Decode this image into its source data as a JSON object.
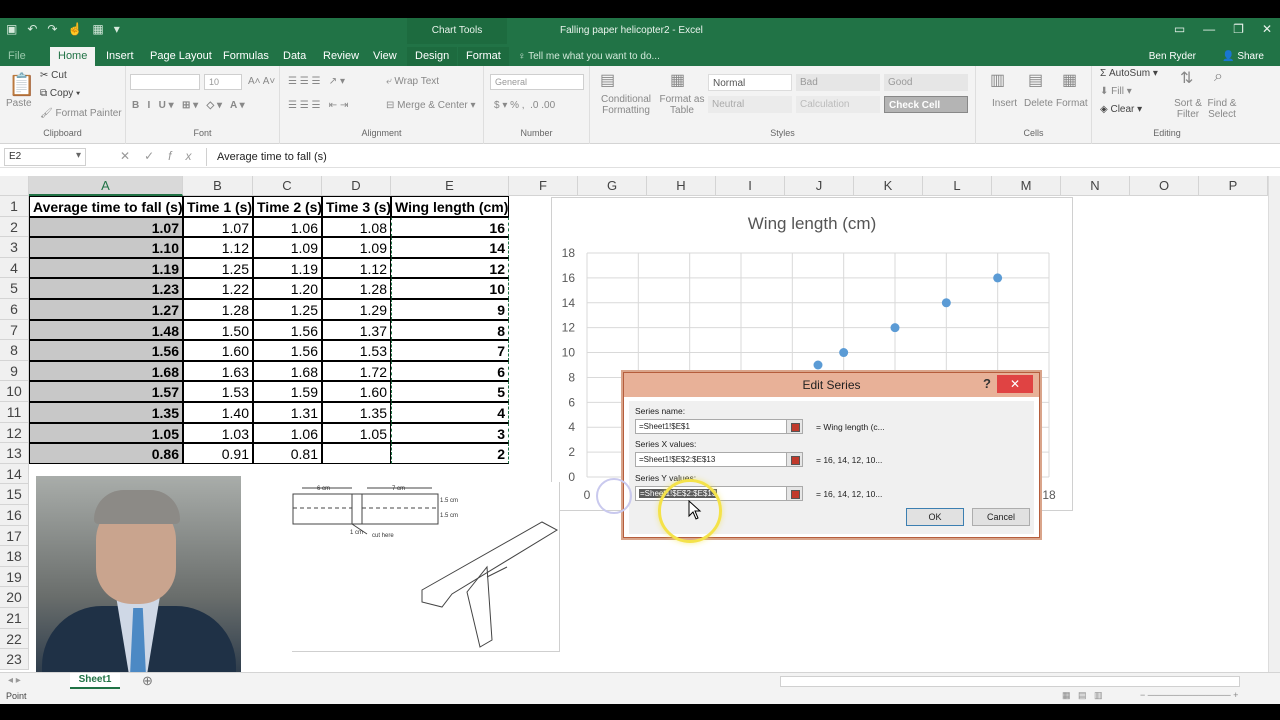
{
  "window": {
    "title": "Falling paper helicopter2 - Excel",
    "context_tab_group": "Chart Tools"
  },
  "tabs": [
    {
      "label": "File"
    },
    {
      "label": "Home"
    },
    {
      "label": "Insert"
    },
    {
      "label": "Page Layout"
    },
    {
      "label": "Formulas"
    },
    {
      "label": "Data"
    },
    {
      "label": "Review"
    },
    {
      "label": "View"
    },
    {
      "label": "Design"
    },
    {
      "label": "Format"
    }
  ],
  "tell_me": "Tell me what you want to do...",
  "user": {
    "name": "Ben Ryder",
    "share": "Share"
  },
  "ribbon": {
    "clipboard": {
      "paste": "Paste",
      "cut": "Cut",
      "copy": "Copy",
      "format_painter": "Format Painter",
      "label": "Clipboard"
    },
    "font": {
      "size": "10",
      "label": "Font"
    },
    "alignment": {
      "wrap": "Wrap Text",
      "merge": "Merge & Center",
      "label": "Alignment"
    },
    "number": {
      "format": "General",
      "label": "Number"
    },
    "styles": {
      "conditional": "Conditional Formatting",
      "format_table": "Format as Table",
      "normal": "Normal",
      "bad": "Bad",
      "good": "Good",
      "neutral": "Neutral",
      "calculation": "Calculation",
      "check": "Check Cell",
      "label": "Styles"
    },
    "cells": {
      "insert": "Insert",
      "delete": "Delete",
      "format": "Format",
      "label": "Cells"
    },
    "editing": {
      "autosum": "AutoSum",
      "fill": "Fill",
      "clear": "Clear",
      "sort": "Sort & Filter",
      "find": "Find & Select",
      "label": "Editing"
    }
  },
  "formula_bar": {
    "name_box": "E2",
    "fx": "fx",
    "content": "Average time to fall (s)"
  },
  "columns": [
    "A",
    "B",
    "C",
    "D",
    "E",
    "F",
    "G",
    "H",
    "I",
    "J",
    "K",
    "L",
    "M",
    "N",
    "O",
    "P"
  ],
  "rows": [
    "1",
    "2",
    "3",
    "4",
    "5",
    "6",
    "7",
    "8",
    "9",
    "10",
    "11",
    "12",
    "13",
    "14",
    "15",
    "16",
    "17",
    "18",
    "19",
    "20",
    "21",
    "22",
    "23"
  ],
  "table": {
    "headers": [
      "Average time to fall (s)",
      "Time 1 (s)",
      "Time 2 (s)",
      "Time 3 (s)",
      "Wing length (cm)"
    ],
    "rows": [
      [
        "1.07",
        "1.07",
        "1.06",
        "1.08",
        "16"
      ],
      [
        "1.10",
        "1.12",
        "1.09",
        "1.09",
        "14"
      ],
      [
        "1.19",
        "1.25",
        "1.19",
        "1.12",
        "12"
      ],
      [
        "1.23",
        "1.22",
        "1.20",
        "1.28",
        "10"
      ],
      [
        "1.27",
        "1.28",
        "1.25",
        "1.29",
        "9"
      ],
      [
        "1.48",
        "1.50",
        "1.56",
        "1.37",
        "8"
      ],
      [
        "1.56",
        "1.60",
        "1.56",
        "1.53",
        "7"
      ],
      [
        "1.68",
        "1.63",
        "1.68",
        "1.72",
        "6"
      ],
      [
        "1.57",
        "1.53",
        "1.59",
        "1.60",
        "5"
      ],
      [
        "1.35",
        "1.40",
        "1.31",
        "1.35",
        "4"
      ],
      [
        "1.05",
        "1.03",
        "1.06",
        "1.05",
        "3"
      ],
      [
        "0.86",
        "0.91",
        "0.81",
        "",
        "2"
      ]
    ]
  },
  "chart_data": {
    "type": "scatter",
    "title": "Wing length (cm)",
    "ylim": [
      0,
      18
    ],
    "xlim": [
      0,
      18
    ],
    "y_ticks": [
      "0",
      "2",
      "4",
      "6",
      "8",
      "10",
      "12",
      "14",
      "16",
      "18"
    ],
    "x_ticks_visible": [
      "0",
      "18"
    ],
    "series": [
      {
        "x": [
          16,
          14,
          12,
          10,
          9
        ],
        "y": [
          16,
          14,
          12,
          10,
          9
        ]
      }
    ]
  },
  "dialog": {
    "title": "Edit Series",
    "help": "?",
    "close": "✕",
    "series_name_label": "Series name:",
    "series_name_value": "=Sheet1!$E$1",
    "series_name_result": "= Wing length (c...",
    "x_label": "Series X values:",
    "x_value": "=Sheet1!$E$2:$E$13",
    "x_result": "= 16, 14, 12, 10...",
    "y_label": "Series Y values:",
    "y_value": "=Sheet1!$E$2:$E$13",
    "y_result": "= 16, 14, 12, 10...",
    "ok": "OK",
    "cancel": "Cancel"
  },
  "drawing": {
    "l1": "6 cm",
    "l2": "7 cm",
    "l3": "1.5 cm",
    "l4": "1.5 cm",
    "l5": "1 cm",
    "l6": "cut here"
  },
  "sheet_tab": "Sheet1",
  "status": "Point"
}
